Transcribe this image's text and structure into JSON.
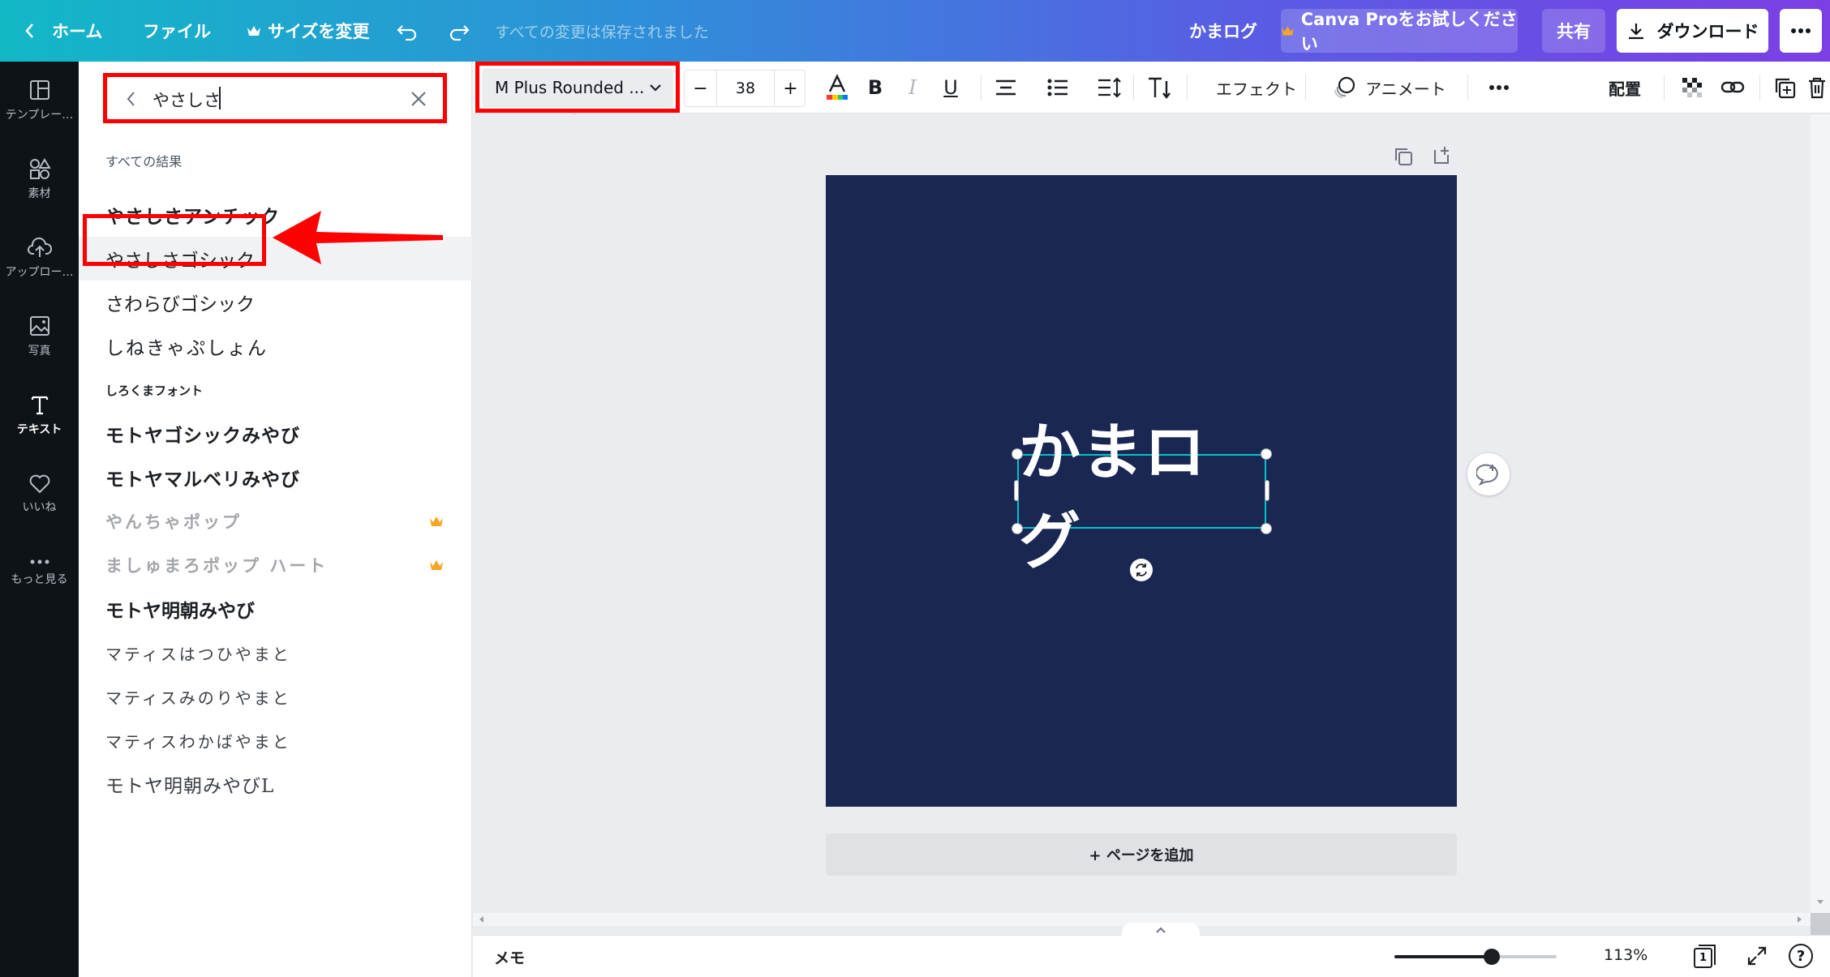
{
  "topbar": {
    "home": "ホーム",
    "file": "ファイル",
    "resize": "サイズを変更",
    "save_status": "すべての変更は保存されました",
    "doc_title": "かまログ",
    "pro_trial": "Canva Proをお試しください",
    "share": "共有",
    "download": "ダウンロード"
  },
  "rail": {
    "templates": "テンプレー…",
    "elements": "素材",
    "uploads": "アップロー…",
    "photos": "写真",
    "text": "テキスト",
    "likes": "いいね",
    "more": "もっと見る"
  },
  "panel": {
    "search_value": "やさしさ",
    "section_title": "すべての結果",
    "fonts": [
      {
        "label": "やさしさアンチック",
        "pro": false
      },
      {
        "label": "やさしさゴシック",
        "pro": false
      },
      {
        "label": "さわらびゴシック",
        "pro": false
      },
      {
        "label": "しねきゃぷしょん",
        "pro": false
      },
      {
        "label": "しろくまフォント",
        "pro": false
      },
      {
        "label": "モトヤゴシックみやび",
        "pro": false
      },
      {
        "label": "モトヤマルベリみやび",
        "pro": false
      },
      {
        "label": "やんちゃポップ",
        "pro": true
      },
      {
        "label": "ましゅまろポップ ハート",
        "pro": true
      },
      {
        "label": "モトヤ明朝みやび",
        "pro": false
      },
      {
        "label": "マティスはつひやまと",
        "pro": false
      },
      {
        "label": "マティスみのりやまと",
        "pro": false
      },
      {
        "label": "マティスわかばやまと",
        "pro": false
      },
      {
        "label": "モトヤ明朝みやびL",
        "pro": false
      }
    ]
  },
  "toolbar": {
    "font_name": "M Plus Rounded ...",
    "font_size": "38",
    "minus": "−",
    "plus": "+",
    "bold": "B",
    "italic": "I",
    "underline": "U",
    "effects": "エフェクト",
    "animate": "アニメート",
    "position": "配置"
  },
  "canvas": {
    "text": "かまログ",
    "bg_color": "#1b2753",
    "add_page": "+ ページを追加"
  },
  "bottom": {
    "notes": "メモ",
    "zoom": "113%",
    "zoom_level": 0.6,
    "page_count": "1"
  },
  "colors": {
    "accent_red": "#ff0000",
    "selection": "#00c4cc",
    "crown": "#f5a623"
  }
}
